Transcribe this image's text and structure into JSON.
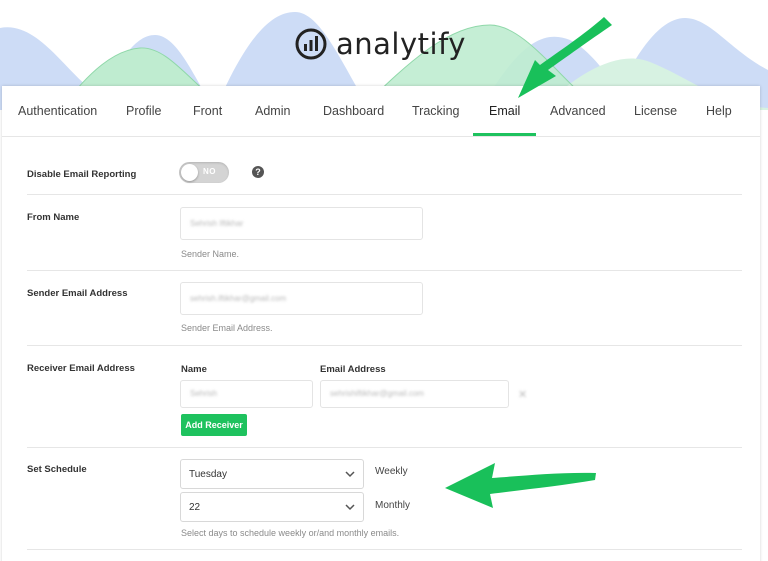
{
  "logo": {
    "text": "analytify"
  },
  "tabs": [
    {
      "label": "Authentication"
    },
    {
      "label": "Profile"
    },
    {
      "label": "Front"
    },
    {
      "label": "Admin"
    },
    {
      "label": "Dashboard"
    },
    {
      "label": "Tracking"
    },
    {
      "label": "Email",
      "active": true
    },
    {
      "label": "Advanced"
    },
    {
      "label": "License"
    },
    {
      "label": "Help"
    }
  ],
  "email_reporting": {
    "label": "Disable Email Reporting",
    "toggle_text": "NO",
    "toggle_on": false
  },
  "from_name": {
    "label": "From Name",
    "value": "Sehrish Iftikhar",
    "hint": "Sender Name."
  },
  "sender_email": {
    "label": "Sender Email Address",
    "value": "sehrish.iftikhar@gmail.com",
    "hint": "Sender Email Address."
  },
  "receiver": {
    "label": "Receiver Email Address",
    "name_header": "Name",
    "email_header": "Email Address",
    "name_value": "Sehrish",
    "email_value": "sehrishiftikhar@gmail.com",
    "add_button": "Add Receiver"
  },
  "schedule": {
    "label": "Set Schedule",
    "weekly_value": "Tuesday",
    "weekly_label": "Weekly",
    "monthly_value": "22",
    "monthly_label": "Monthly",
    "hint": "Select days to schedule weekly or/and monthly emails."
  },
  "colors": {
    "accent": "#1ec25e",
    "wave_blue": "#ccdcf7",
    "wave_green": "#bfecd0"
  }
}
